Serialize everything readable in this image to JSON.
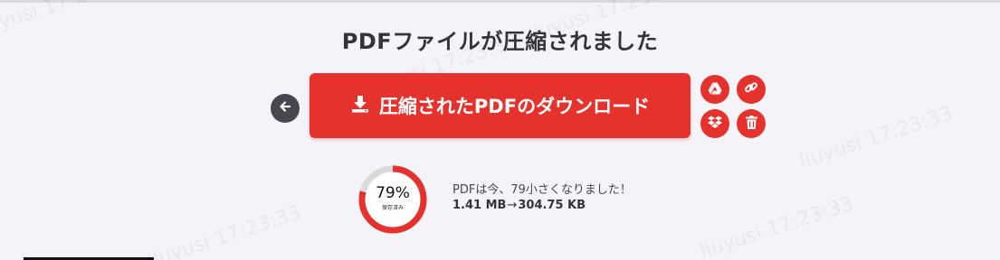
{
  "page": {
    "title": "PDFファイルが圧縮されました"
  },
  "actions": {
    "back_icon": "arrow-left-icon",
    "download_label": "圧縮されたPDFのダウンロード",
    "download_icon": "download-icon",
    "share_icons": [
      "google-drive-icon",
      "link-icon",
      "dropbox-icon",
      "trash-icon"
    ]
  },
  "result": {
    "percent_label": "79%",
    "percent_value": 0.79,
    "saved_label": "保存済み",
    "message": "PDFは今、79小さくなりました！",
    "original_size": "1.41 MB",
    "arrow": "→",
    "compressed_size": "304.75 KB"
  },
  "watermark": {
    "text": "liuyusi 17:23:33"
  },
  "colors": {
    "accent": "#e5322d",
    "back_button": "#47474f",
    "ring_track": "#d9d9de",
    "background": "#f4f4f8"
  }
}
